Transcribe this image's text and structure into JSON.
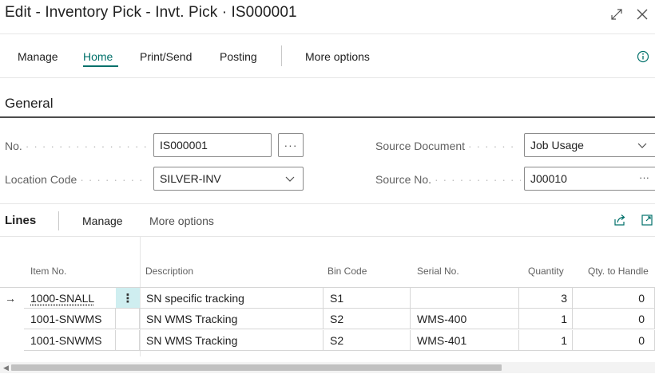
{
  "window": {
    "title": "Edit - Inventory Pick - Invt. Pick · IS000001"
  },
  "actions": {
    "manage": "Manage",
    "home": "Home",
    "print_send": "Print/Send",
    "posting": "Posting",
    "more_options": "More options"
  },
  "general": {
    "title": "General",
    "no": {
      "label": "No.",
      "value": "IS000001"
    },
    "location_code": {
      "label": "Location Code",
      "value": "SILVER-INV"
    },
    "source_document": {
      "label": "Source Document",
      "value": "Job Usage"
    },
    "source_no": {
      "label": "Source No.",
      "value": "J00010"
    }
  },
  "lines": {
    "title": "Lines",
    "manage": "Manage",
    "more_options": "More options",
    "columns": {
      "item_no": "Item No.",
      "description": "Description",
      "bin_code": "Bin Code",
      "serial_no": "Serial No.",
      "quantity": "Quantity",
      "qty_to_handle": "Qty. to Handle"
    },
    "rows": [
      {
        "indicator": "→",
        "item_no": "1000-SNALL",
        "description": "SN specific tracking",
        "bin_code": "S1",
        "serial_no": "",
        "quantity": "3",
        "qty_to_handle": "0"
      },
      {
        "indicator": "",
        "item_no": "1001-SNWMS",
        "description": "SN WMS Tracking",
        "bin_code": "S2",
        "serial_no": "WMS-400",
        "quantity": "1",
        "qty_to_handle": "0"
      },
      {
        "indicator": "",
        "item_no": "1001-SNWMS",
        "description": "SN WMS Tracking",
        "bin_code": "S2",
        "serial_no": "WMS-401",
        "quantity": "1",
        "qty_to_handle": "0"
      }
    ]
  },
  "colors": {
    "accent": "#00706a",
    "selected_cell": "#cfeef0"
  }
}
